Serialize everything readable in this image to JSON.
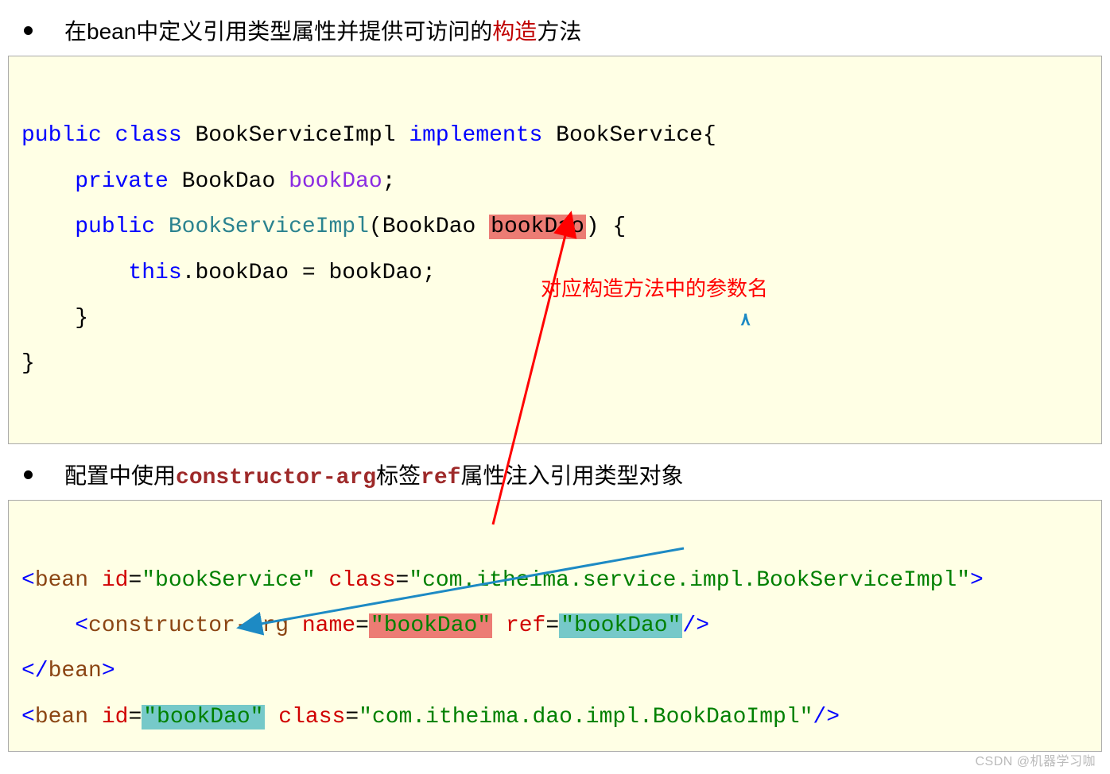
{
  "bullet1": {
    "prefix": "在bean中定义引用类型属性并提供可访问的",
    "highlight": "构造",
    "suffix": "方法"
  },
  "code1": {
    "l1_public": "public",
    "l1_class": "class",
    "l1_name": " BookServiceImpl ",
    "l1_impl": "implements",
    "l1_iface": " BookService{",
    "l2_priv": "private",
    "l2_type": " BookDao ",
    "l2_field": "bookDao",
    "l2_semi": ";",
    "l3_pub": "public",
    "l3_space": " ",
    "l3_ctor": "BookServiceImpl",
    "l3_open": "(BookDao ",
    "l3_param": "bookDao",
    "l3_close": ") {",
    "l4_this": "this",
    "l4_dot": ".bookDao = bookDao;",
    "l5": "    }",
    "l6": "}"
  },
  "annotation_red": "对应构造方法中的参数名",
  "cursor_char": "٨",
  "bullet2": {
    "prefix": "配置中使用",
    "code1": "constructor-arg",
    "mid": "标签",
    "code2": "ref",
    "suffix": "属性注入引用类型对象"
  },
  "code2": {
    "l1_open": "<",
    "l1_tag": "bean ",
    "l1_attr_id": "id",
    "l1_eq1": "=",
    "l1_val1": "\"bookService\"",
    "l1_sp": " ",
    "l1_attr_cls": "class",
    "l1_eq2": "=",
    "l1_val2": "\"com.itheima.service.impl.BookServiceImpl\"",
    "l1_close": ">",
    "l2_indent": "    ",
    "l2_open": "<",
    "l2_tag": "constructor-arg ",
    "l2_attr_name": "name",
    "l2_eq1": "=",
    "l2_val1": "\"bookDao\"",
    "l2_sp": " ",
    "l2_attr_ref": "ref",
    "l2_eq2": "=",
    "l2_val2": "\"bookDao\"",
    "l2_close": "/>",
    "l3_open": "</",
    "l3_tag": "bean",
    "l3_close": ">",
    "l4_open": "<",
    "l4_tag": "bean ",
    "l4_attr_id": "id",
    "l4_eq1": "=",
    "l4_val1": "\"bookDao\"",
    "l4_sp": " ",
    "l4_attr_cls": "class",
    "l4_eq2": "=",
    "l4_val2": "\"com.itheima.dao.impl.BookDaoImpl\"",
    "l4_close": "/>"
  },
  "watermark": "CSDN @机器学习咖"
}
